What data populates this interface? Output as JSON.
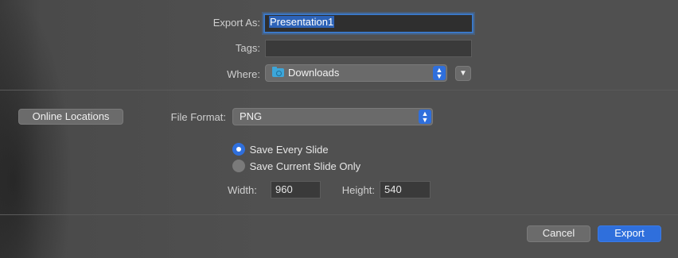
{
  "export_as": {
    "label": "Export As:",
    "value": "Presentation1"
  },
  "tags": {
    "label": "Tags:",
    "value": ""
  },
  "where": {
    "label": "Where:",
    "value": "Downloads",
    "icon": "folder-icon"
  },
  "online_locations": {
    "label": "Online Locations"
  },
  "file_format": {
    "label": "File Format:",
    "value": "PNG"
  },
  "options": {
    "save_every_slide": "Save Every Slide",
    "save_current_slide": "Save Current Slide Only",
    "selected": "save_every_slide"
  },
  "size": {
    "width_label": "Width:",
    "width_value": "960",
    "height_label": "Height:",
    "height_value": "540"
  },
  "buttons": {
    "cancel": "Cancel",
    "export": "Export"
  },
  "colors": {
    "accent": "#2f6fdc",
    "background": "#505050"
  }
}
